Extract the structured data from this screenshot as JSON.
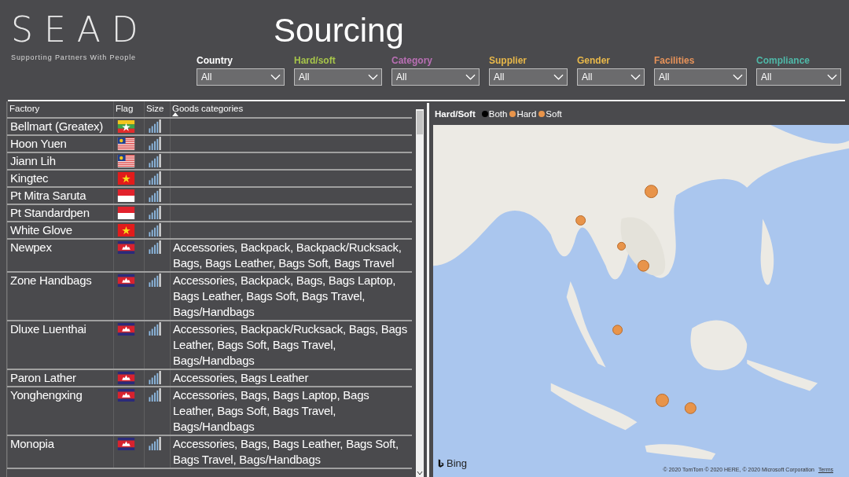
{
  "logo": {
    "mark": "S E A D",
    "tagline": "Supporting Partners With People"
  },
  "title": "Sourcing",
  "filters": [
    {
      "label": "Country",
      "color": "#ffffff",
      "value": "All"
    },
    {
      "label": "Hard/soft",
      "color": "#a6c44a",
      "value": "All"
    },
    {
      "label": "Category",
      "color": "#b96fb4",
      "value": "All"
    },
    {
      "label": "Supplier",
      "color": "#e8b84a",
      "value": "All"
    },
    {
      "label": "Gender",
      "color": "#e8b84a",
      "value": "All"
    },
    {
      "label": "Facilities",
      "color": "#e7935a",
      "value": "All"
    },
    {
      "label": "Compliance",
      "color": "#4fb8a8",
      "value": "All"
    }
  ],
  "table": {
    "columns": [
      "Factory",
      "Flag",
      "Size",
      "Goods categories"
    ],
    "rows": [
      {
        "factory": "Bellmart (Greatex)",
        "kind": "myanmar",
        "goods": ""
      },
      {
        "factory": "Hoon Yuen",
        "kind": "malaysia",
        "goods": ""
      },
      {
        "factory": "Jiann Lih",
        "kind": "malaysia",
        "goods": ""
      },
      {
        "factory": "Kingtec",
        "kind": "vietnam",
        "goods": ""
      },
      {
        "factory": "Pt Mitra Saruta",
        "kind": "indonesia",
        "goods": ""
      },
      {
        "factory": "Pt Standardpen",
        "kind": "indonesia",
        "goods": ""
      },
      {
        "factory": "White Glove",
        "kind": "vietnam",
        "goods": ""
      },
      {
        "factory": "Newpex",
        "kind": "cambodia",
        "goods": "Accessories, Backpack, Backpack/Rucksack, Bags, Bags Leather, Bags Soft, Bags Travel"
      },
      {
        "factory": "Zone Handbags",
        "kind": "cambodia",
        "goods": "Accessories, Backpack, Bags, Bags Laptop, Bags Leather, Bags Soft, Bags Travel, Bags/Handbags"
      },
      {
        "factory": "Dluxe Luenthai",
        "kind": "cambodia",
        "goods": "Accessories, Backpack/Rucksack, Bags, Bags Leather, Bags Soft, Bags Travel, Bags/Handbags"
      },
      {
        "factory": "Paron Lather",
        "kind": "cambodia",
        "goods": "Accessories, Bags Leather"
      },
      {
        "factory": "Yonghengxing",
        "kind": "cambodia",
        "goods": "Accessories, Bags, Bags Laptop, Bags Leather, Bags Soft, Bags Travel, Bags/Handbags"
      },
      {
        "factory": "Monopia",
        "kind": "cambodia",
        "goods": "Accessories, Bags, Bags Leather, Bags Soft, Bags Travel, Bags/Handbags"
      }
    ]
  },
  "map": {
    "legend_title": "Hard/Soft",
    "legend": [
      {
        "label": "Both",
        "color": "#000000"
      },
      {
        "label": "Hard",
        "color": "#e8944a"
      },
      {
        "label": "Soft",
        "color": "#e8944a"
      }
    ],
    "provider": "Bing",
    "copyright": "© 2020 TomTom © 2020 HERE, © 2020 Microsoft Corporation",
    "terms_link": "Terms"
  }
}
